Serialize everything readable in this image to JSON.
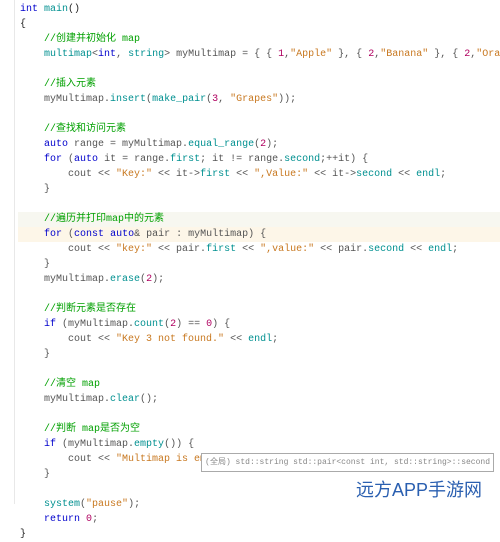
{
  "lines": [
    {
      "cls": "",
      "frags": [
        {
          "t": "int ",
          "c": "k"
        },
        {
          "t": "main",
          "c": "t"
        },
        {
          "t": "()",
          "c": "brace"
        }
      ]
    },
    {
      "cls": "",
      "frags": [
        {
          "t": "{",
          "c": "brace"
        }
      ]
    },
    {
      "cls": "",
      "frags": [
        {
          "t": "    ",
          "c": ""
        },
        {
          "t": "//创建并初始化 map",
          "c": "c"
        }
      ]
    },
    {
      "cls": "",
      "frags": [
        {
          "t": "    ",
          "c": ""
        },
        {
          "t": "multimap",
          "c": "t"
        },
        {
          "t": "<",
          "c": "p"
        },
        {
          "t": "int",
          "c": "k"
        },
        {
          "t": ", ",
          "c": "p"
        },
        {
          "t": "string",
          "c": "t"
        },
        {
          "t": "> myMultimap = { { ",
          "c": "p"
        },
        {
          "t": "1",
          "c": "n"
        },
        {
          "t": ",",
          "c": "p"
        },
        {
          "t": "\"Apple\"",
          "c": "s"
        },
        {
          "t": " }, { ",
          "c": "p"
        },
        {
          "t": "2",
          "c": "n"
        },
        {
          "t": ",",
          "c": "p"
        },
        {
          "t": "\"Banana\"",
          "c": "s"
        },
        {
          "t": " }, { ",
          "c": "p"
        },
        {
          "t": "2",
          "c": "n"
        },
        {
          "t": ",",
          "c": "p"
        },
        {
          "t": "\"Orange\"",
          "c": "s"
        },
        {
          "t": " } };",
          "c": "p"
        }
      ]
    },
    {
      "cls": "",
      "frags": [
        {
          "t": " ",
          "c": ""
        }
      ]
    },
    {
      "cls": "",
      "frags": [
        {
          "t": "    ",
          "c": ""
        },
        {
          "t": "//插入元素",
          "c": "c"
        }
      ]
    },
    {
      "cls": "",
      "frags": [
        {
          "t": "    ",
          "c": ""
        },
        {
          "t": "myMultimap.",
          "c": "p"
        },
        {
          "t": "insert",
          "c": "t"
        },
        {
          "t": "(",
          "c": "p"
        },
        {
          "t": "make_pair",
          "c": "t"
        },
        {
          "t": "(",
          "c": "p"
        },
        {
          "t": "3",
          "c": "n"
        },
        {
          "t": ", ",
          "c": "p"
        },
        {
          "t": "\"Grapes\"",
          "c": "s"
        },
        {
          "t": "));",
          "c": "p"
        }
      ]
    },
    {
      "cls": "",
      "frags": [
        {
          "t": " ",
          "c": ""
        }
      ]
    },
    {
      "cls": "",
      "frags": [
        {
          "t": "    ",
          "c": ""
        },
        {
          "t": "//查找和访问元素",
          "c": "c"
        }
      ]
    },
    {
      "cls": "",
      "frags": [
        {
          "t": "    ",
          "c": ""
        },
        {
          "t": "auto",
          "c": "k"
        },
        {
          "t": " range = myMultimap.",
          "c": "p"
        },
        {
          "t": "equal_range",
          "c": "t"
        },
        {
          "t": "(",
          "c": "p"
        },
        {
          "t": "2",
          "c": "n"
        },
        {
          "t": ");",
          "c": "p"
        }
      ]
    },
    {
      "cls": "",
      "frags": [
        {
          "t": "    ",
          "c": ""
        },
        {
          "t": "for",
          "c": "k"
        },
        {
          "t": " (",
          "c": "p"
        },
        {
          "t": "auto",
          "c": "k"
        },
        {
          "t": " it = range.",
          "c": "p"
        },
        {
          "t": "first",
          "c": "t"
        },
        {
          "t": "; it != range.",
          "c": "p"
        },
        {
          "t": "second",
          "c": "t"
        },
        {
          "t": ";++it) {",
          "c": "p"
        }
      ]
    },
    {
      "cls": "",
      "frags": [
        {
          "t": "        ",
          "c": ""
        },
        {
          "t": "cout << ",
          "c": "p"
        },
        {
          "t": "\"Key:\"",
          "c": "s"
        },
        {
          "t": " << it->",
          "c": "p"
        },
        {
          "t": "first",
          "c": "t"
        },
        {
          "t": " << ",
          "c": "p"
        },
        {
          "t": "\",Value:\"",
          "c": "s"
        },
        {
          "t": " << it->",
          "c": "p"
        },
        {
          "t": "second",
          "c": "t"
        },
        {
          "t": " << ",
          "c": "p"
        },
        {
          "t": "endl",
          "c": "t"
        },
        {
          "t": ";",
          "c": "p"
        }
      ]
    },
    {
      "cls": "",
      "frags": [
        {
          "t": "    }",
          "c": "p"
        }
      ]
    },
    {
      "cls": "",
      "frags": [
        {
          "t": " ",
          "c": ""
        }
      ]
    },
    {
      "cls": "hl1",
      "frags": [
        {
          "t": "    ",
          "c": ""
        },
        {
          "t": "//遍历并打印map中的元素",
          "c": "c"
        }
      ]
    },
    {
      "cls": "hl2",
      "frags": [
        {
          "t": "    ",
          "c": ""
        },
        {
          "t": "for",
          "c": "k"
        },
        {
          "t": " (",
          "c": "p"
        },
        {
          "t": "const",
          "c": "k"
        },
        {
          "t": " ",
          "c": ""
        },
        {
          "t": "auto",
          "c": "k"
        },
        {
          "t": "& pair : myMultimap) {",
          "c": "p"
        }
      ]
    },
    {
      "cls": "",
      "frags": [
        {
          "t": "        ",
          "c": ""
        },
        {
          "t": "cout << ",
          "c": "p"
        },
        {
          "t": "\"key:\"",
          "c": "s"
        },
        {
          "t": " << pair.",
          "c": "p"
        },
        {
          "t": "first",
          "c": "t"
        },
        {
          "t": " << ",
          "c": "p"
        },
        {
          "t": "\",value:\"",
          "c": "s"
        },
        {
          "t": " << pair.",
          "c": "p"
        },
        {
          "t": "second",
          "c": "t"
        },
        {
          "t": " << ",
          "c": "p"
        },
        {
          "t": "endl",
          "c": "t"
        },
        {
          "t": ";",
          "c": "p"
        }
      ]
    },
    {
      "cls": "",
      "frags": [
        {
          "t": "    }",
          "c": "p"
        }
      ]
    },
    {
      "cls": "",
      "frags": [
        {
          "t": "    ",
          "c": ""
        },
        {
          "t": "myMultimap.",
          "c": "p"
        },
        {
          "t": "erase",
          "c": "t"
        },
        {
          "t": "(",
          "c": "p"
        },
        {
          "t": "2",
          "c": "n"
        },
        {
          "t": ");",
          "c": "p"
        }
      ]
    },
    {
      "cls": "",
      "frags": [
        {
          "t": " ",
          "c": ""
        }
      ]
    },
    {
      "cls": "",
      "frags": [
        {
          "t": "    ",
          "c": ""
        },
        {
          "t": "//判断元素是否存在",
          "c": "c"
        }
      ]
    },
    {
      "cls": "",
      "frags": [
        {
          "t": "    ",
          "c": ""
        },
        {
          "t": "if",
          "c": "k"
        },
        {
          "t": " (myMultimap.",
          "c": "p"
        },
        {
          "t": "count",
          "c": "t"
        },
        {
          "t": "(",
          "c": "p"
        },
        {
          "t": "2",
          "c": "n"
        },
        {
          "t": ") == ",
          "c": "p"
        },
        {
          "t": "0",
          "c": "n"
        },
        {
          "t": ") {",
          "c": "p"
        }
      ]
    },
    {
      "cls": "",
      "frags": [
        {
          "t": "        ",
          "c": ""
        },
        {
          "t": "cout << ",
          "c": "p"
        },
        {
          "t": "\"Key 3 not found.\"",
          "c": "s"
        },
        {
          "t": " << ",
          "c": "p"
        },
        {
          "t": "endl",
          "c": "t"
        },
        {
          "t": ";",
          "c": "p"
        }
      ]
    },
    {
      "cls": "",
      "frags": [
        {
          "t": "    }",
          "c": "p"
        }
      ]
    },
    {
      "cls": "",
      "frags": [
        {
          "t": " ",
          "c": ""
        }
      ]
    },
    {
      "cls": "",
      "frags": [
        {
          "t": "    ",
          "c": ""
        },
        {
          "t": "//清空 map",
          "c": "c"
        }
      ]
    },
    {
      "cls": "",
      "frags": [
        {
          "t": "    ",
          "c": ""
        },
        {
          "t": "myMultimap.",
          "c": "p"
        },
        {
          "t": "clear",
          "c": "t"
        },
        {
          "t": "();",
          "c": "p"
        }
      ]
    },
    {
      "cls": "",
      "frags": [
        {
          "t": " ",
          "c": ""
        }
      ]
    },
    {
      "cls": "",
      "frags": [
        {
          "t": "    ",
          "c": ""
        },
        {
          "t": "//判断 map是否为空",
          "c": "c"
        }
      ]
    },
    {
      "cls": "",
      "frags": [
        {
          "t": "    ",
          "c": ""
        },
        {
          "t": "if",
          "c": "k"
        },
        {
          "t": " (myMultimap.",
          "c": "p"
        },
        {
          "t": "empty",
          "c": "t"
        },
        {
          "t": "()) {",
          "c": "p"
        }
      ]
    },
    {
      "cls": "",
      "frags": [
        {
          "t": "        ",
          "c": ""
        },
        {
          "t": "cout << ",
          "c": "p"
        },
        {
          "t": "\"Multimap is empty.\"",
          "c": "s"
        },
        {
          "t": " << ",
          "c": "p"
        },
        {
          "t": "endl",
          "c": "t"
        },
        {
          "t": ";",
          "c": "p"
        }
      ]
    },
    {
      "cls": "",
      "frags": [
        {
          "t": "    }",
          "c": "p"
        }
      ]
    },
    {
      "cls": "",
      "frags": [
        {
          "t": " ",
          "c": ""
        }
      ]
    },
    {
      "cls": "",
      "frags": [
        {
          "t": "    ",
          "c": ""
        },
        {
          "t": "system",
          "c": "t"
        },
        {
          "t": "(",
          "c": "p"
        },
        {
          "t": "\"pause\"",
          "c": "s"
        },
        {
          "t": ");",
          "c": "p"
        }
      ]
    },
    {
      "cls": "",
      "frags": [
        {
          "t": "    ",
          "c": ""
        },
        {
          "t": "return",
          "c": "k"
        },
        {
          "t": " ",
          "c": ""
        },
        {
          "t": "0",
          "c": "n"
        },
        {
          "t": ";",
          "c": "p"
        }
      ]
    },
    {
      "cls": "",
      "frags": [
        {
          "t": "}",
          "c": "brace"
        }
      ]
    }
  ],
  "tooltip": "(全局) std::string std::pair<const int, std::string>::second",
  "watermark": "远方APP手游网"
}
